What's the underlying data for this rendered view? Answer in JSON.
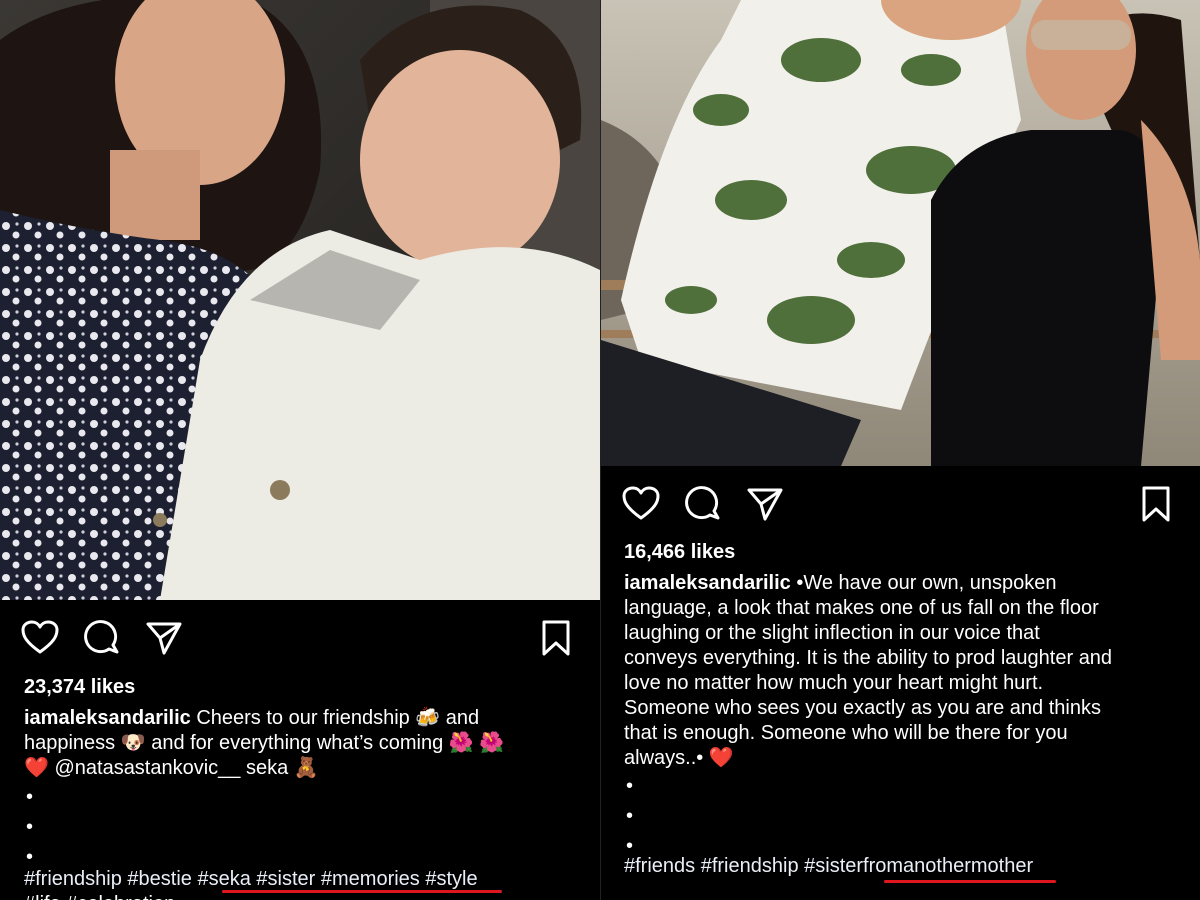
{
  "left": {
    "likes": "23,374 likes",
    "username": "iamaleksandarilic",
    "caption_line1": " Cheers to our friendship 🍻 and",
    "caption_line2": "happiness 🐶 and for everything what’s coming 🌺 🌺",
    "caption_line3": "❤️ @natasastankovic__ seka 🧸",
    "dots": [
      "•",
      "•",
      "•"
    ],
    "hashtags": [
      "#friendship",
      "#bestie",
      "#seka",
      "#sister",
      "#memories",
      "#style"
    ],
    "hashtags_cut_line": "#life #celebration"
  },
  "right": {
    "likes": "16,466 likes",
    "username": "iamaleksandarilic",
    "caption_lines": [
      " •We have our own, unspoken",
      "language, a look that makes one of us fall on the floor",
      "laughing or the slight inflection in our voice that",
      "conveys everything. It is the ability to prod laughter and",
      "love no matter how much your heart might hurt.",
      "Someone who sees you exactly as you are and thinks",
      "that is enough. Someone who will be there for you",
      "always..• ❤️"
    ],
    "dots": [
      "•",
      "•",
      "•"
    ],
    "hashtags": [
      "#friends",
      "#friendship",
      "#sisterfromanothermother"
    ]
  },
  "icons": {
    "like": "heart-icon",
    "comment": "comment-icon",
    "share": "send-icon",
    "save": "bookmark-icon"
  },
  "colors": {
    "background": "#000000",
    "text": "#ffffff",
    "underline": "#e0161e"
  }
}
